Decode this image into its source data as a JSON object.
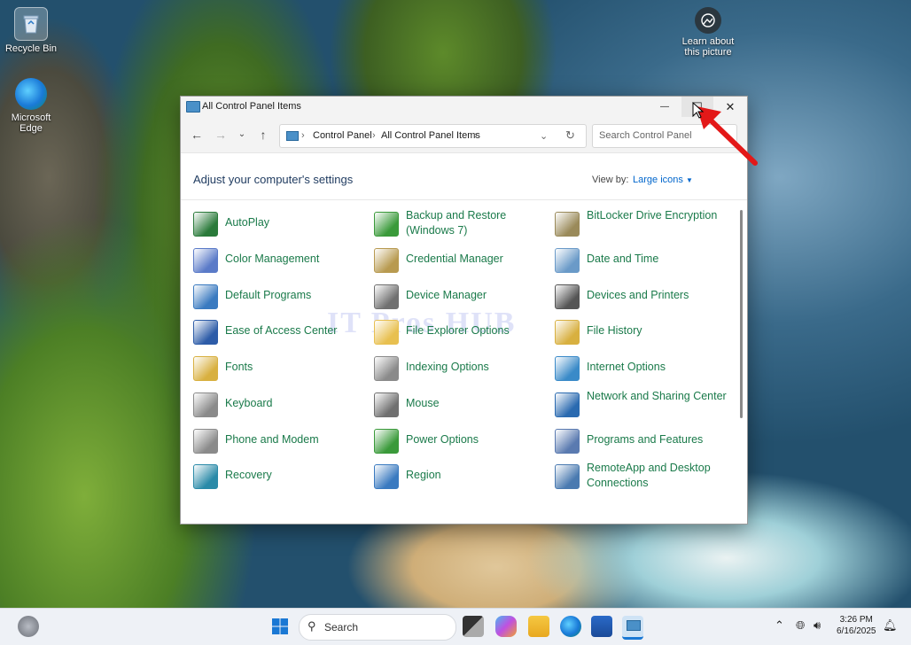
{
  "desktop": {
    "icons": [
      {
        "label": "Recycle Bin"
      },
      {
        "label": "Microsoft Edge"
      },
      {
        "label": "Learn about this picture"
      }
    ]
  },
  "window": {
    "title": "All Control Panel Items",
    "controls": {
      "minimize": "—",
      "maximize": "☐",
      "close": "✕"
    },
    "breadcrumb": [
      "Control Panel",
      "All Control Panel Items"
    ],
    "search_placeholder": "Search Control Panel",
    "heading": "Adjust your computer's settings",
    "view_by_label": "View by:",
    "view_mode": "Large icons",
    "watermark": "IT Pros HUB",
    "items": [
      {
        "label": "AutoPlay",
        "icon": "autoplay-icon",
        "color": "#2a7a3a"
      },
      {
        "label": "Backup and Restore (Windows 7)",
        "icon": "backup-icon",
        "color": "#3a9a3a"
      },
      {
        "label": "BitLocker Drive Encryption",
        "icon": "bitlocker-icon",
        "color": "#9a8a5a"
      },
      {
        "label": "Color Management",
        "icon": "color-management-icon",
        "color": "#5a7ac8"
      },
      {
        "label": "Credential Manager",
        "icon": "credential-icon",
        "color": "#b89a50"
      },
      {
        "label": "Date and Time",
        "icon": "clock-icon",
        "color": "#6a9ac8"
      },
      {
        "label": "Default Programs",
        "icon": "default-programs-icon",
        "color": "#3a7ac0"
      },
      {
        "label": "Device Manager",
        "icon": "device-manager-icon",
        "color": "#707070"
      },
      {
        "label": "Devices and Printers",
        "icon": "printer-icon",
        "color": "#555555"
      },
      {
        "label": "Ease of Access Center",
        "icon": "ease-of-access-icon",
        "color": "#2d5ca8"
      },
      {
        "label": "File Explorer Options",
        "icon": "folder-options-icon",
        "color": "#e8c050"
      },
      {
        "label": "File History",
        "icon": "file-history-icon",
        "color": "#d8b040"
      },
      {
        "label": "Fonts",
        "icon": "fonts-icon",
        "color": "#d8b040"
      },
      {
        "label": "Indexing Options",
        "icon": "indexing-icon",
        "color": "#8a8a8a"
      },
      {
        "label": "Internet Options",
        "icon": "globe-icon",
        "color": "#3a8ac8"
      },
      {
        "label": "Keyboard",
        "icon": "keyboard-icon",
        "color": "#8a8a8a"
      },
      {
        "label": "Mouse",
        "icon": "mouse-icon",
        "color": "#707070"
      },
      {
        "label": "Network and Sharing Center",
        "icon": "network-icon",
        "color": "#2a6ab0"
      },
      {
        "label": "Phone and Modem",
        "icon": "phone-modem-icon",
        "color": "#8a8a8a"
      },
      {
        "label": "Power Options",
        "icon": "power-icon",
        "color": "#3a9a3a"
      },
      {
        "label": "Programs and Features",
        "icon": "programs-icon",
        "color": "#5a7ab0"
      },
      {
        "label": "Recovery",
        "icon": "recovery-icon",
        "color": "#2a8aa8"
      },
      {
        "label": "Region",
        "icon": "region-icon",
        "color": "#3a7ac0"
      },
      {
        "label": "RemoteApp and Desktop Connections",
        "icon": "remoteapp-icon",
        "color": "#4a7ab0"
      }
    ]
  },
  "taskbar": {
    "search_label": "Search",
    "time": "3:26 PM",
    "date": "6/16/2025"
  }
}
